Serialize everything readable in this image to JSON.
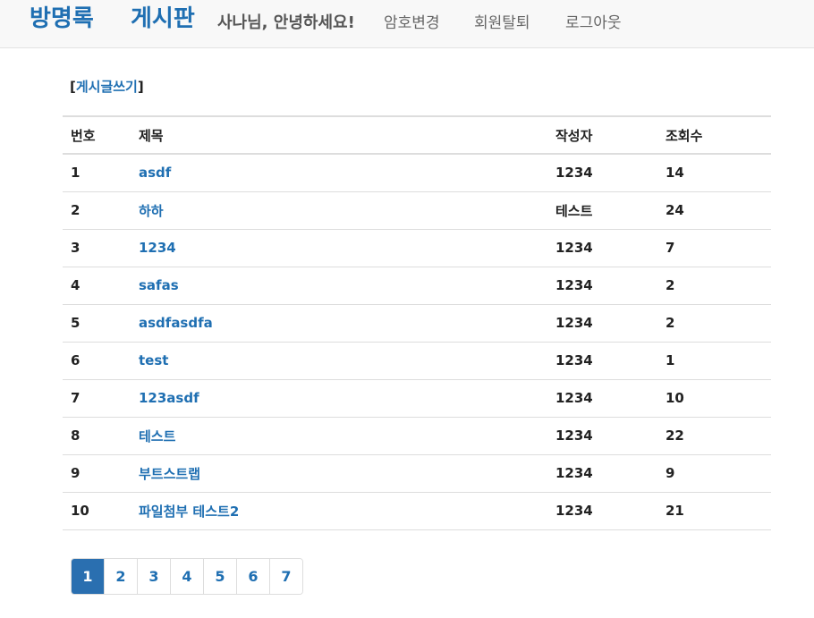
{
  "navbar": {
    "brand_guestbook": "방명록",
    "brand_board": "게시판",
    "greeting": "사나님, 안녕하세요!",
    "links": {
      "change_password": "암호변경",
      "withdraw": "회원탈퇴",
      "logout": "로그아웃"
    }
  },
  "write": {
    "open_bracket": "[",
    "label": "게시글쓰기",
    "close_bracket": "]"
  },
  "table": {
    "headers": [
      "번호",
      "제목",
      "작성자",
      "조회수"
    ],
    "rows": [
      {
        "num": "1",
        "title": "asdf",
        "writer": "1234",
        "views": "14"
      },
      {
        "num": "2",
        "title": "하하",
        "writer": "테스트",
        "views": "24"
      },
      {
        "num": "3",
        "title": "1234",
        "writer": "1234",
        "views": "7"
      },
      {
        "num": "4",
        "title": "safas",
        "writer": "1234",
        "views": "2"
      },
      {
        "num": "5",
        "title": "asdfasdfa",
        "writer": "1234",
        "views": "2"
      },
      {
        "num": "6",
        "title": "test",
        "writer": "1234",
        "views": "1"
      },
      {
        "num": "7",
        "title": "123asdf",
        "writer": "1234",
        "views": "10"
      },
      {
        "num": "8",
        "title": "테스트",
        "writer": "1234",
        "views": "22"
      },
      {
        "num": "9",
        "title": "부트스트랩",
        "writer": "1234",
        "views": "9"
      },
      {
        "num": "10",
        "title": "파일첨부 테스트2",
        "writer": "1234",
        "views": "21"
      }
    ]
  },
  "pagination": {
    "pages": [
      "1",
      "2",
      "3",
      "4",
      "5",
      "6",
      "7"
    ],
    "active": "1"
  },
  "colors": {
    "accent": "#1f6fb2",
    "active_page_bg": "#2a6fb0",
    "navbar_bg": "#f8f8f8"
  }
}
